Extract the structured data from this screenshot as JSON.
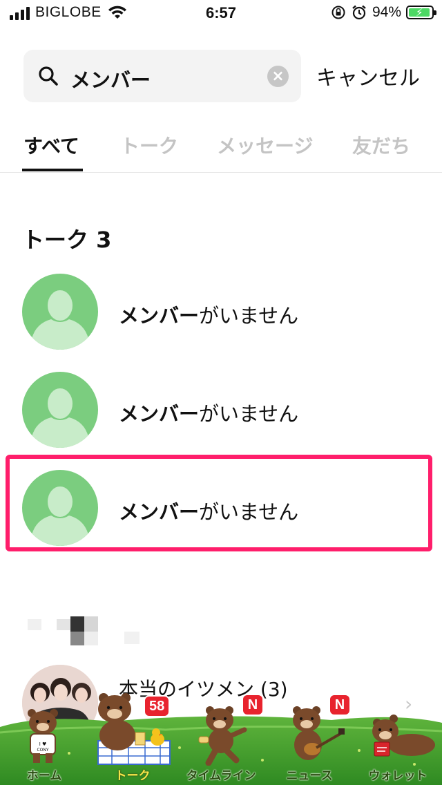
{
  "status_bar": {
    "carrier": "BIGLOBE",
    "time": "6:57",
    "battery_percent": "94%",
    "battery_level": 0.94
  },
  "search": {
    "query": "メンバー",
    "cancel_label": "キャンセル"
  },
  "tabs": [
    {
      "label": "すべて",
      "active": true
    },
    {
      "label": "トーク",
      "active": false
    },
    {
      "label": "メッセージ",
      "active": false
    },
    {
      "label": "友だち",
      "active": false
    }
  ],
  "section": {
    "title": "トーク 3"
  },
  "results": [
    {
      "match": "メンバー",
      "rest": "がいません"
    },
    {
      "match": "メンバー",
      "rest": "がいません"
    },
    {
      "match": "メンバー",
      "rest": "がいません"
    }
  ],
  "group_row": {
    "label": "本当のイツメン (3)"
  },
  "bottom_tabs": [
    {
      "label": "ホーム",
      "icon": "home-bear-icon",
      "badge": ""
    },
    {
      "label": "トーク",
      "icon": "chat-bear-icon",
      "badge": "58",
      "active": true
    },
    {
      "label": "タイムライン",
      "icon": "timeline-bear-icon",
      "badge": "N"
    },
    {
      "label": "ニュース",
      "icon": "news-bear-icon",
      "badge": "N"
    },
    {
      "label": "ウォレット",
      "icon": "wallet-bear-icon",
      "badge": ""
    }
  ],
  "colors": {
    "highlight": "#ff1e6b",
    "avatar_green": "#7bcd7f",
    "badge_red": "#e8232e",
    "grass_green": "#3d9a2a"
  }
}
